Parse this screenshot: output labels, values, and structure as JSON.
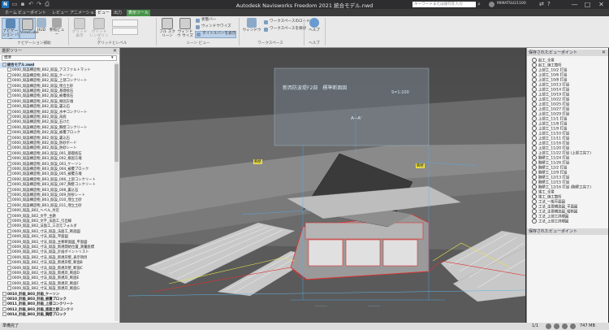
{
  "window": {
    "title": "Autodesk Navisworks Freedom 2021  統合モデル.nwd",
    "search_placeholder": "キーワードまたは語句を入力",
    "user": "MIMATSU21100",
    "controls": [
      "—",
      "□",
      "✕"
    ]
  },
  "ribbon": {
    "tabs": [
      "ホーム",
      "ビューポイント",
      "レビュー",
      "アニメーション",
      "ビュー",
      "出力",
      "表示ツール"
    ],
    "active_tab": "ビュー",
    "buttons": {
      "navigation": "ナビゲーション バー",
      "viewcube": "ViewCube",
      "hud": "HUD",
      "reference_view": "参照ビュー",
      "grid_show": "グリッド表示",
      "grid_rendering": "グリッド レンダリング",
      "full_screen": "フル スクリーン",
      "window_size": "ウィンドウ サイズ",
      "status_bar": "状態バー",
      "window_wise": "ウィンドウワイズ",
      "title_bar": "タイトルバーを表示",
      "windows": "ウィンドウ",
      "load_workspace": "ワークスペースのロード",
      "save_workspace": "ワークスペースを保存",
      "help": "ヘルプ"
    },
    "groups": [
      "ナビゲーション補助",
      "グリッドとレベル",
      "シーン ビュー",
      "ワークスペース",
      "ヘルプ"
    ]
  },
  "selection_tree": {
    "title": "選択ツリー",
    "filter_value": "標準",
    "items": [
      {
        "label": "統合モデル.nwd",
        "bold": true,
        "selected": true,
        "indent": 0
      },
      {
        "label": "0000_既設構造物_B02_既設_アスファルトマット",
        "indent": 1
      },
      {
        "label": "0000_既設構造物_B02_既設_ケーソン",
        "indent": 1
      },
      {
        "label": "0000_既設構造物_B02_既設_上部コンクリート",
        "indent": 1
      },
      {
        "label": "0000_既設構造物_B02_既設_埋立土砂",
        "indent": 1
      },
      {
        "label": "0000_既設構造物_B02_既設_基礎捨石",
        "indent": 1
      },
      {
        "label": "0000_既設構造物_B02_既設_被覆捨石",
        "indent": 1
      },
      {
        "label": "0000_既設構造物_B02_既設_根固方塊",
        "indent": 1
      },
      {
        "label": "0000_既設構造物_B02_既設_裏込石",
        "indent": 1
      },
      {
        "label": "0000_既設構造物_B02_既設_水中コンクリート",
        "indent": 1
      },
      {
        "label": "0000_既設構造物_B02_既設_海底",
        "indent": 1
      },
      {
        "label": "0000_既設構造物_B02_既設_石けた",
        "indent": 1
      },
      {
        "label": "0000_既設構造物_B02_既設_胸壁コンクリート",
        "indent": 1
      },
      {
        "label": "0000_既設構造物_B02_既設_被覆ブロック",
        "indent": 1
      },
      {
        "label": "0000_既設構造物_B02_既設_裏込石",
        "indent": 1
      },
      {
        "label": "0000_既設構造物_B02_既設_防砂ボード",
        "indent": 1
      },
      {
        "label": "0000_既設構造物_B02_既設_防砂シート",
        "indent": 1
      },
      {
        "label": "0000_既設構造物_B03_既設_001_基礎捨石",
        "indent": 1
      },
      {
        "label": "0000_既設構造物_B03_既設_002_根固方塊",
        "indent": 1
      },
      {
        "label": "0000_既設構造物_B03_既設_003_ケーソン",
        "indent": 1
      },
      {
        "label": "0000_既設構造物_B03_既設_004_被覆ブロック",
        "indent": 1
      },
      {
        "label": "0000_既設構造物_B03_既設_005_被覆方塊",
        "indent": 1
      },
      {
        "label": "0000_既設構造物_B03_既設_006_上部コンクリート",
        "indent": 1
      },
      {
        "label": "0000_既設構造物_B03_既設_007_胸壁コンクリート",
        "indent": 1
      },
      {
        "label": "0000_既設構造物_B03_既設_008_裏込石",
        "indent": 1
      },
      {
        "label": "0000_既設構造物_B03_既設_009_防砂シート",
        "indent": 1
      },
      {
        "label": "0000_既設構造物_B03_既設_010_埋立土砂",
        "indent": 1
      },
      {
        "label": "0000_既設構造物_B03_既設_011_埋立土砂",
        "indent": 1
      },
      {
        "label": "0000_既設_B02_ヘペル_付近",
        "indent": 1
      },
      {
        "label": "0009_既設_B02_文字_主題",
        "indent": 1
      },
      {
        "label": "0009_既設_B02_文字_法面工_引出線",
        "indent": 1
      },
      {
        "label": "0009_既設_B02_法面工_三次元フォルダ",
        "indent": 1
      },
      {
        "label": "0009_既設_B02_寸法_既設_法面工_断面図",
        "indent": 1
      },
      {
        "label": "0009_既設_B02_寸法_既設_平面図",
        "indent": 1
      },
      {
        "label": "0009_既設_B02_寸法_既設_主要断面図_平面図",
        "indent": 1
      },
      {
        "label": "0009_既設_B02_寸法_既設_新規開始位置_測量座標",
        "indent": 1
      },
      {
        "label": "0009_既設_B02_寸法_既設_計画ポイントリスト",
        "indent": 1
      },
      {
        "label": "0009_既設_B02_寸法_既設_新規岸壁_表示項目",
        "indent": 1
      },
      {
        "label": "0009_既設_B02_寸法_既設_新規岸壁_断面B",
        "indent": 1
      },
      {
        "label": "0009_既設_B02_寸法_既設_新規岸壁_断面C",
        "indent": 1
      },
      {
        "label": "0009_既設_B02_寸法_既設_新規岸_断面D",
        "indent": 1
      },
      {
        "label": "0009_既設_B02_寸法_既設_新規岸_断面E",
        "indent": 1
      },
      {
        "label": "0009_既設_B02_寸法_既設_新規岸_断面F",
        "indent": 1
      },
      {
        "label": "0009_既設_B02_寸法_既設_新規岸_断面G",
        "indent": 1
      },
      {
        "label": "0010_計画_B03_計画_ケーソン",
        "bold": true,
        "indent": 0
      },
      {
        "label": "0010_計画_B03_計画_被覆ブロック",
        "bold": true,
        "indent": 0
      },
      {
        "label": "0011_計画_B03_計画_上部コンクリート",
        "bold": true,
        "indent": 0
      },
      {
        "label": "0012_計画_B03_計画_底面土砂コンクリ",
        "bold": true,
        "indent": 0
      },
      {
        "label": "0014_計画_B03_計画_胸壁ブロック",
        "bold": true,
        "indent": 0
      }
    ]
  },
  "saved_viewpoints": {
    "title": "保存されたビューポイント",
    "items": [
      "起工_全景",
      "起工_施工箇所",
      "上部工_10/2 打設",
      "上部工_10/6 打設",
      "上部工_10/8 打設",
      "上部工_10/13 打設",
      "上部工_10/14 打設",
      "上部工_10/19 打設",
      "上部工_10/22 打設",
      "上部工_10/25 打設",
      "上部工_10/27 打設",
      "上部工_10/29 打設",
      "上部工_11/1 打設",
      "上部工_11/8 打設",
      "上部工_11/9 打設",
      "上部工_11/10 打設",
      "上部工_11/11 打設",
      "上部工_11/16 打設",
      "上部工_11/20 打設",
      "上部工_11/22 打設 (上部工完了)",
      "胸壁工_11/24 打設",
      "胸壁工_11/26 打設",
      "胸壁工_12/2 打設",
      "胸壁工_12/9 打設",
      "胸壁工_12/13 打設",
      "胸壁工_12/15 打設",
      "胸壁工_12/16 打設 (胸壁工完了)",
      "竣工_全景",
      "竣工_施工箇所",
      "工法_一般平面図",
      "工法_主要構造図_平面図",
      "工法_主要構造図_縦断図",
      "工法_上部工詳細図",
      "工法_上部工詳細図"
    ],
    "footer_title": "保存されたビューポイント"
  },
  "viewport": {
    "drawing_title": "新西防波堤F2部　標準断面図",
    "scale_note": "S=1:100",
    "section_label": "A−A'",
    "tag_left": "胸壁",
    "tag_right": "胸壁"
  },
  "status_bar": {
    "text": "準備完了",
    "page": "1/1",
    "size": "747 MB"
  }
}
